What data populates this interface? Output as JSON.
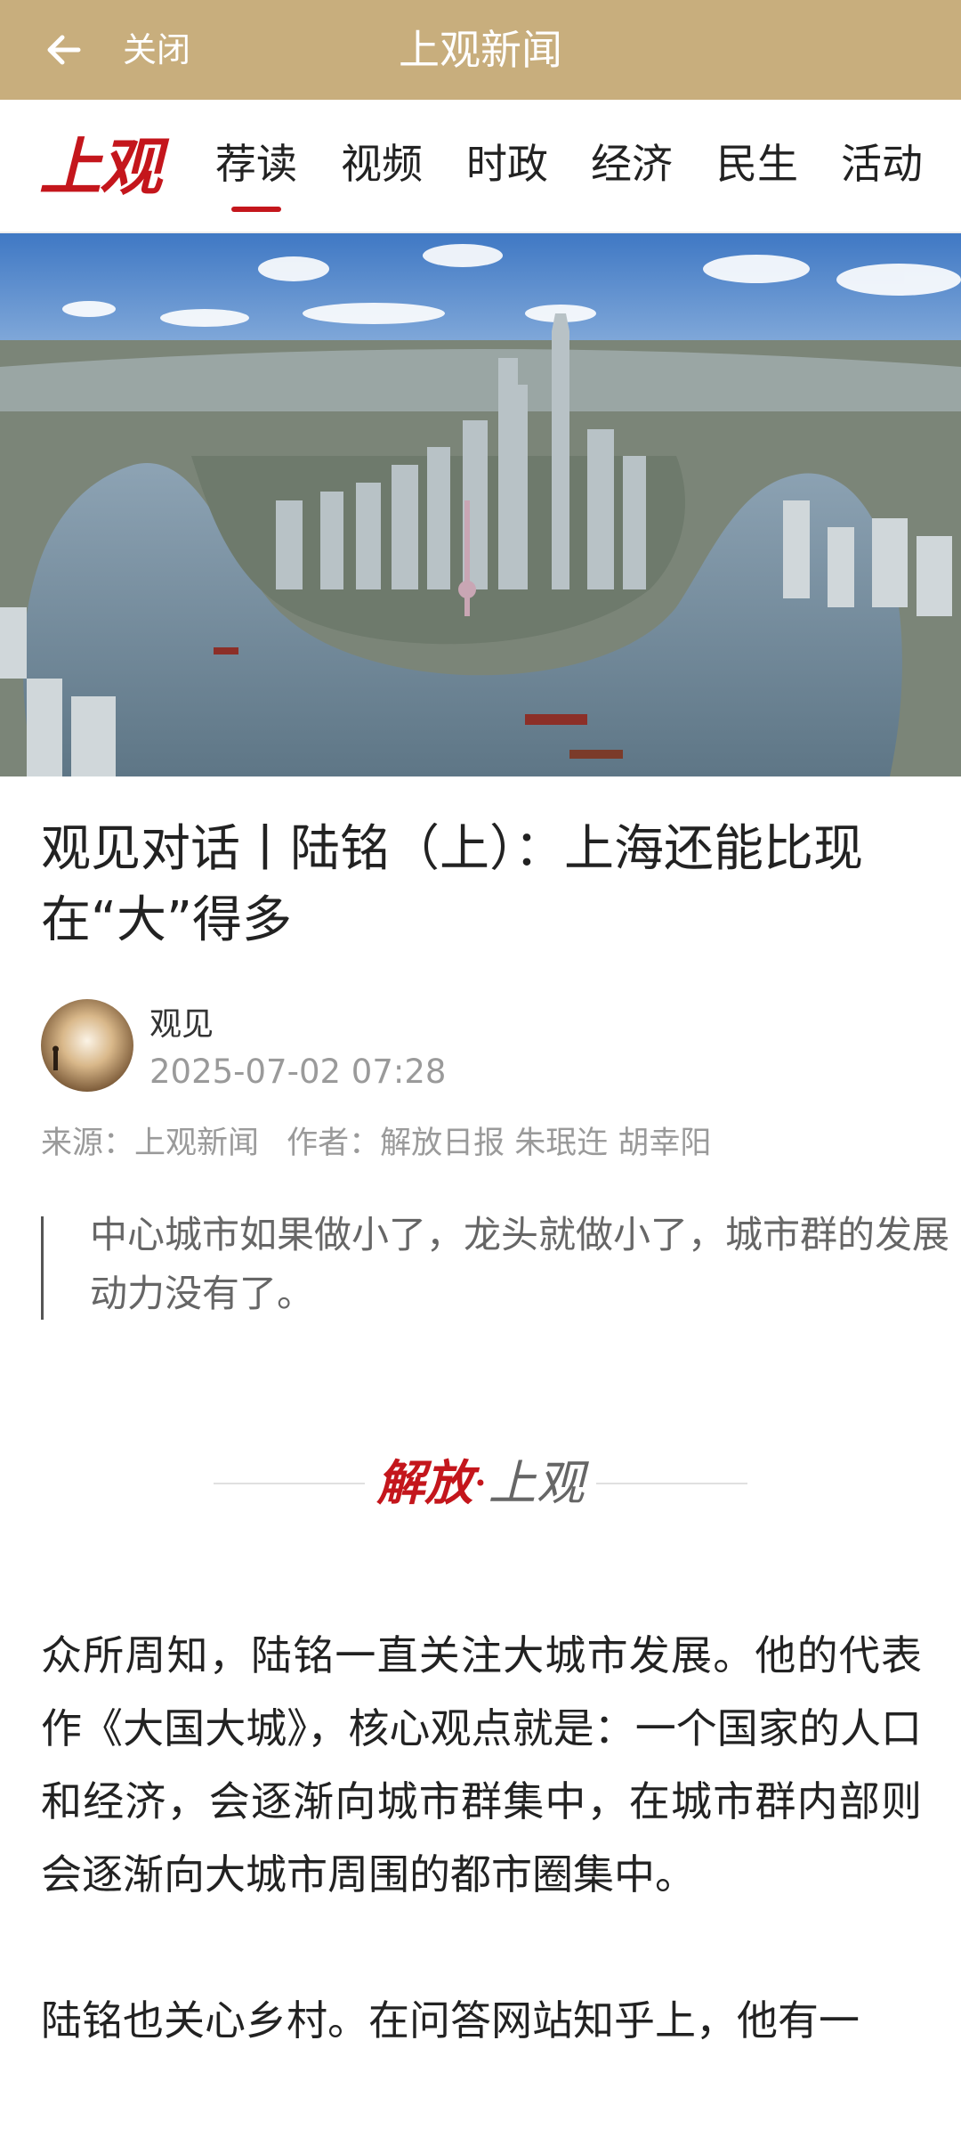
{
  "topbar": {
    "back_icon": "arrow-left-icon",
    "close_label": "关闭",
    "title": "上观新闻"
  },
  "nav": {
    "logo": "上观",
    "tabs": [
      "荐读",
      "视频",
      "时政",
      "经济",
      "民生",
      "活动"
    ],
    "active_tab": "荐读",
    "accent": "#c4161c"
  },
  "article": {
    "title": "观见对话丨陆铭（上）：上海还能比现在“大”得多",
    "author_name": "观见",
    "publish_time": "2025-07-02 07:28",
    "source_label": "来源：上观新闻",
    "author_label": "作者：解放日报 朱珉迕 胡幸阳",
    "quote": "中心城市如果做小了，龙头就做小了，城市群的发展动力没有了。",
    "brand_left": "解放",
    "brand_dot": "·",
    "brand_right": "上观",
    "paragraphs": [
      "众所周知，陆铭一直关注大城市发展。他的代表作《大国大城》，核心观点就是：一个国家的人口和经济，会逐渐向城市群集中，在城市群内部则会逐渐向大城市周围的都市圈集中。",
      "陆铭也关心乡村。在问答网站知乎上，他有一"
    ]
  },
  "colors": {
    "topbar_bg": "#c8ae7d",
    "accent_red": "#c4161c",
    "muted_text": "#9a9a9a"
  }
}
